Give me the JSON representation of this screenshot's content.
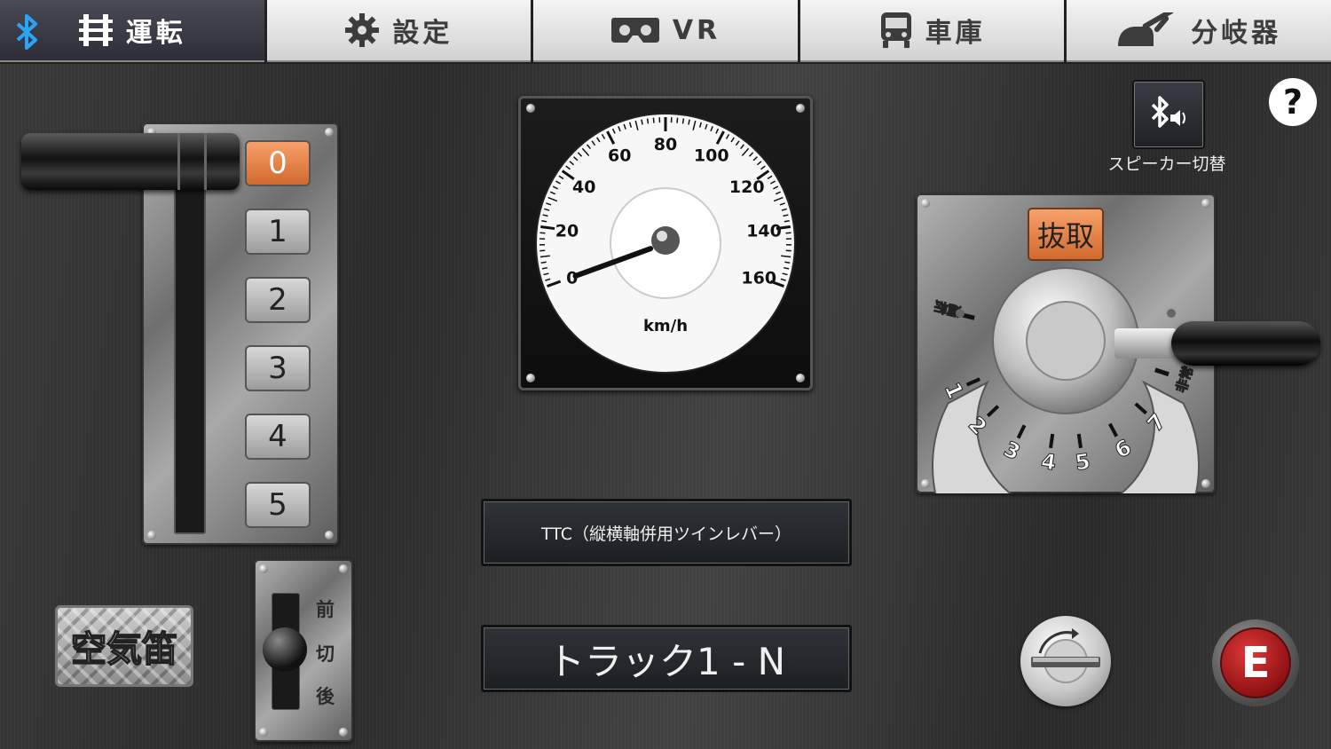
{
  "tabs": [
    {
      "label": "運転",
      "icon": "track-icon",
      "active": true
    },
    {
      "label": "設定",
      "icon": "gear-icon",
      "active": false
    },
    {
      "label": "VR",
      "icon": "vr-goggles-icon",
      "active": false
    },
    {
      "label": "車庫",
      "icon": "train-icon",
      "active": false
    },
    {
      "label": "分岐器",
      "icon": "turnout-switch-icon",
      "active": false
    }
  ],
  "bluetooth_icon": "bluetooth-icon",
  "notch": {
    "positions": [
      "0",
      "1",
      "2",
      "3",
      "4",
      "5"
    ],
    "selected": "0"
  },
  "speedometer": {
    "unit": "km/h",
    "ticks": [
      "0",
      "20",
      "40",
      "60",
      "80",
      "100",
      "120",
      "140",
      "160"
    ],
    "min": 0,
    "max": 160,
    "current_speed": 0
  },
  "speaker": {
    "icon": "bluetooth-speaker-icon",
    "label": "スピーカー切替"
  },
  "help": {
    "label": "?"
  },
  "brake": {
    "release_label": "抜取",
    "positions": [
      "運転",
      "1",
      "2",
      "3",
      "4",
      "5",
      "6",
      "7",
      "非常"
    ],
    "current": "運転"
  },
  "controller_type": "TTC（縦横軸併用ツインレバー）",
  "track_name": "トラック1 - N",
  "whistle": {
    "label": "空気笛"
  },
  "direction": {
    "labels": [
      "前",
      "切",
      "後"
    ],
    "current": "切"
  },
  "emergency": {
    "label": "E"
  }
}
